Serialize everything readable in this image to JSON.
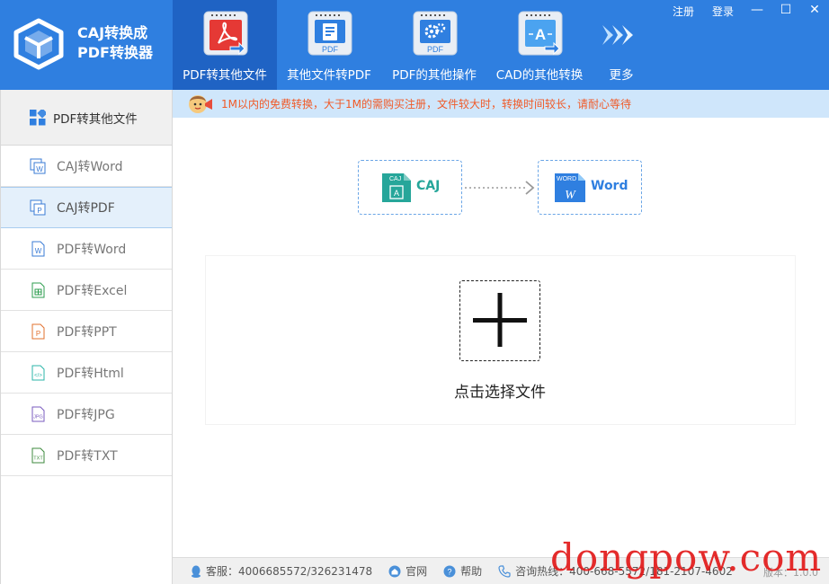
{
  "app": {
    "title_line1": "CAJ转换成",
    "title_line2": "PDF转换器"
  },
  "window": {
    "register": "注册",
    "login": "登录",
    "minimize_glyph": "—",
    "restore_glyph": "☐",
    "close_glyph": "✕"
  },
  "toolbar": [
    {
      "label": "PDF转其他文件",
      "icon": "pdf-acrobat-icon",
      "badge": ""
    },
    {
      "label": "其他文件转PDF",
      "icon": "pdf-document-icon",
      "badge": "PDF"
    },
    {
      "label": "PDF的其他操作",
      "icon": "pdf-gear-icon",
      "badge": "PDF"
    },
    {
      "label": "CAD的其他转换",
      "icon": "cad-convert-icon",
      "badge": "A"
    }
  ],
  "more": {
    "label": "更多",
    "icon": "chevron-arrows-icon"
  },
  "sidebar": {
    "header": "PDF转其他文件",
    "items": [
      {
        "label": "CAJ转Word",
        "icon": "caj-word-icon",
        "color": "#3a7bd5"
      },
      {
        "label": "CAJ转PDF",
        "icon": "caj-pdf-icon",
        "color": "#3a7bd5"
      },
      {
        "label": "PDF转Word",
        "icon": "word-file-icon",
        "color": "#3a7bd5"
      },
      {
        "label": "PDF转Excel",
        "icon": "excel-file-icon",
        "color": "#2e9e4f"
      },
      {
        "label": "PDF转PPT",
        "icon": "ppt-file-icon",
        "color": "#e2702e"
      },
      {
        "label": "PDF转Html",
        "icon": "html-file-icon",
        "color": "#2bb5a8"
      },
      {
        "label": "PDF转JPG",
        "icon": "jpg-file-icon",
        "color": "#7a5bbf"
      },
      {
        "label": "PDF转TXT",
        "icon": "txt-file-icon",
        "color": "#3c8a3c"
      }
    ],
    "active_index": 1
  },
  "notice": {
    "text": "1M以内的免费转换，大于1M的需购买注册，文件较大时，转换时间较长，请耐心等待"
  },
  "conversion": {
    "source": {
      "label": "CAJ",
      "badge": "CAJ",
      "color": "#26a69a"
    },
    "target": {
      "label": "Word",
      "badge": "WORD",
      "color": "#2f7fe0"
    }
  },
  "dropzone": {
    "label": "点击选择文件"
  },
  "status": {
    "service": "客服：4006685572/326231478",
    "website": "官网",
    "help": "帮助",
    "hotline": "咨询热线：400-668-5572/181-2107-4602",
    "version": "版本：1.0.0"
  },
  "watermark": "dongpow.com",
  "colors": {
    "header": "#2f7fe0",
    "header_active": "#1f63c4",
    "notice_bg": "#cfe6fb",
    "notice_text": "#f05a28"
  }
}
